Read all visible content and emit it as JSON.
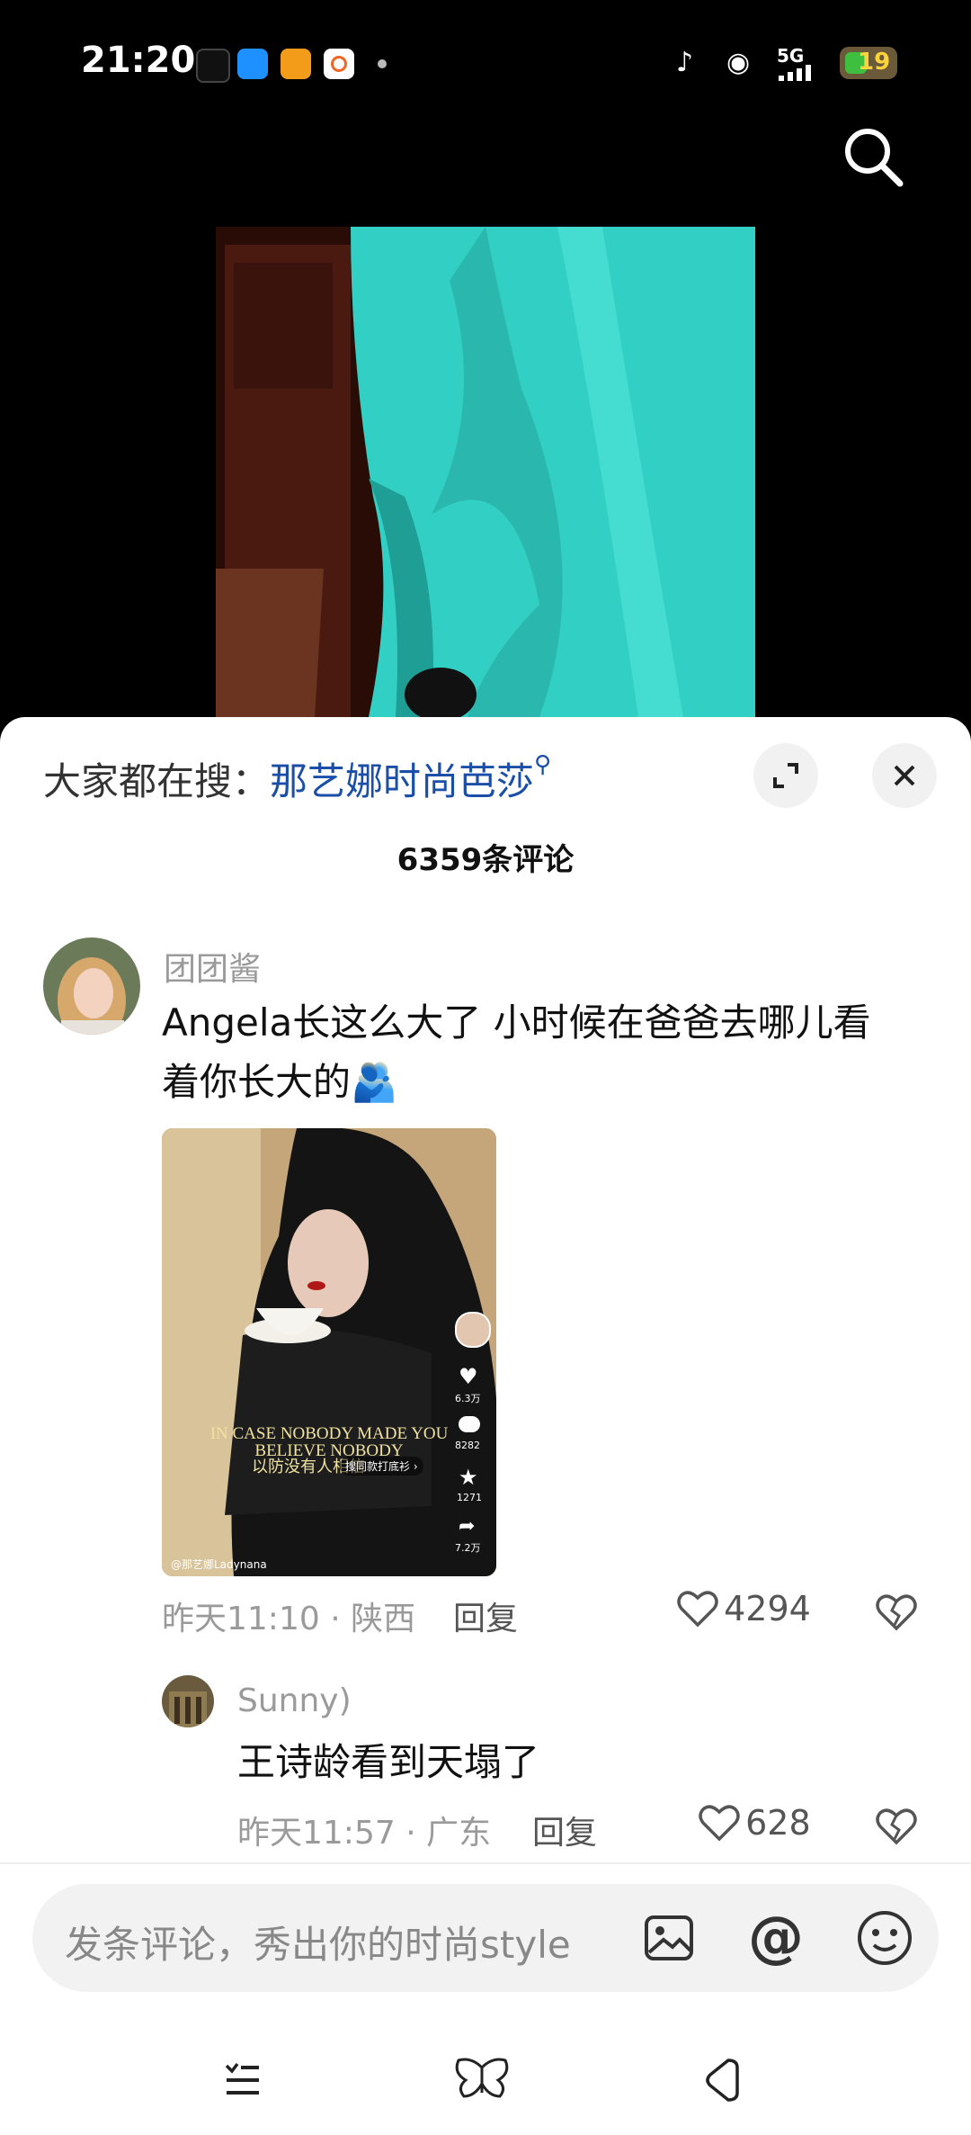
{
  "status_bar": {
    "time": "21:20",
    "indicators": [
      "5G"
    ],
    "battery": "19"
  },
  "header": {
    "search_prompt_label": "大家都在搜：",
    "search_keyword": "那艺娜时尚芭莎"
  },
  "comments_panel": {
    "count_label": "6359条评论",
    "comments": [
      {
        "username": "团团酱",
        "text_line1": "Angela长这么大了 小时候在爸爸去哪儿看",
        "text_line2": "着你长大的🫂",
        "meta": "昨天11:10 · 陕西",
        "reply_label": "回复",
        "likes": "4294",
        "image": {
          "caption_line1": "IN CASE NOBODY MADE YOU",
          "caption_line2": "BELIEVE NOBODY",
          "caption_cn": "以防没有人相信",
          "tag": "搜同款打底衫 ›",
          "author": "@那艺娜Ladynana",
          "like_count": "6.3万",
          "comment_count": "8282",
          "fav_count": "1271",
          "share_count": "7.2万"
        }
      },
      {
        "username": "Sunny)",
        "text": "王诗龄看到天塌了",
        "meta": "昨天11:57 · 广东",
        "reply_label": "回复",
        "likes": "628"
      }
    ]
  },
  "input": {
    "placeholder": "发条评论，秀出你的时尚style"
  },
  "colors": {
    "keyword": "#1a4ea8",
    "sheet_bg": "#ffffff",
    "teal_dress": "#31cfc4"
  }
}
